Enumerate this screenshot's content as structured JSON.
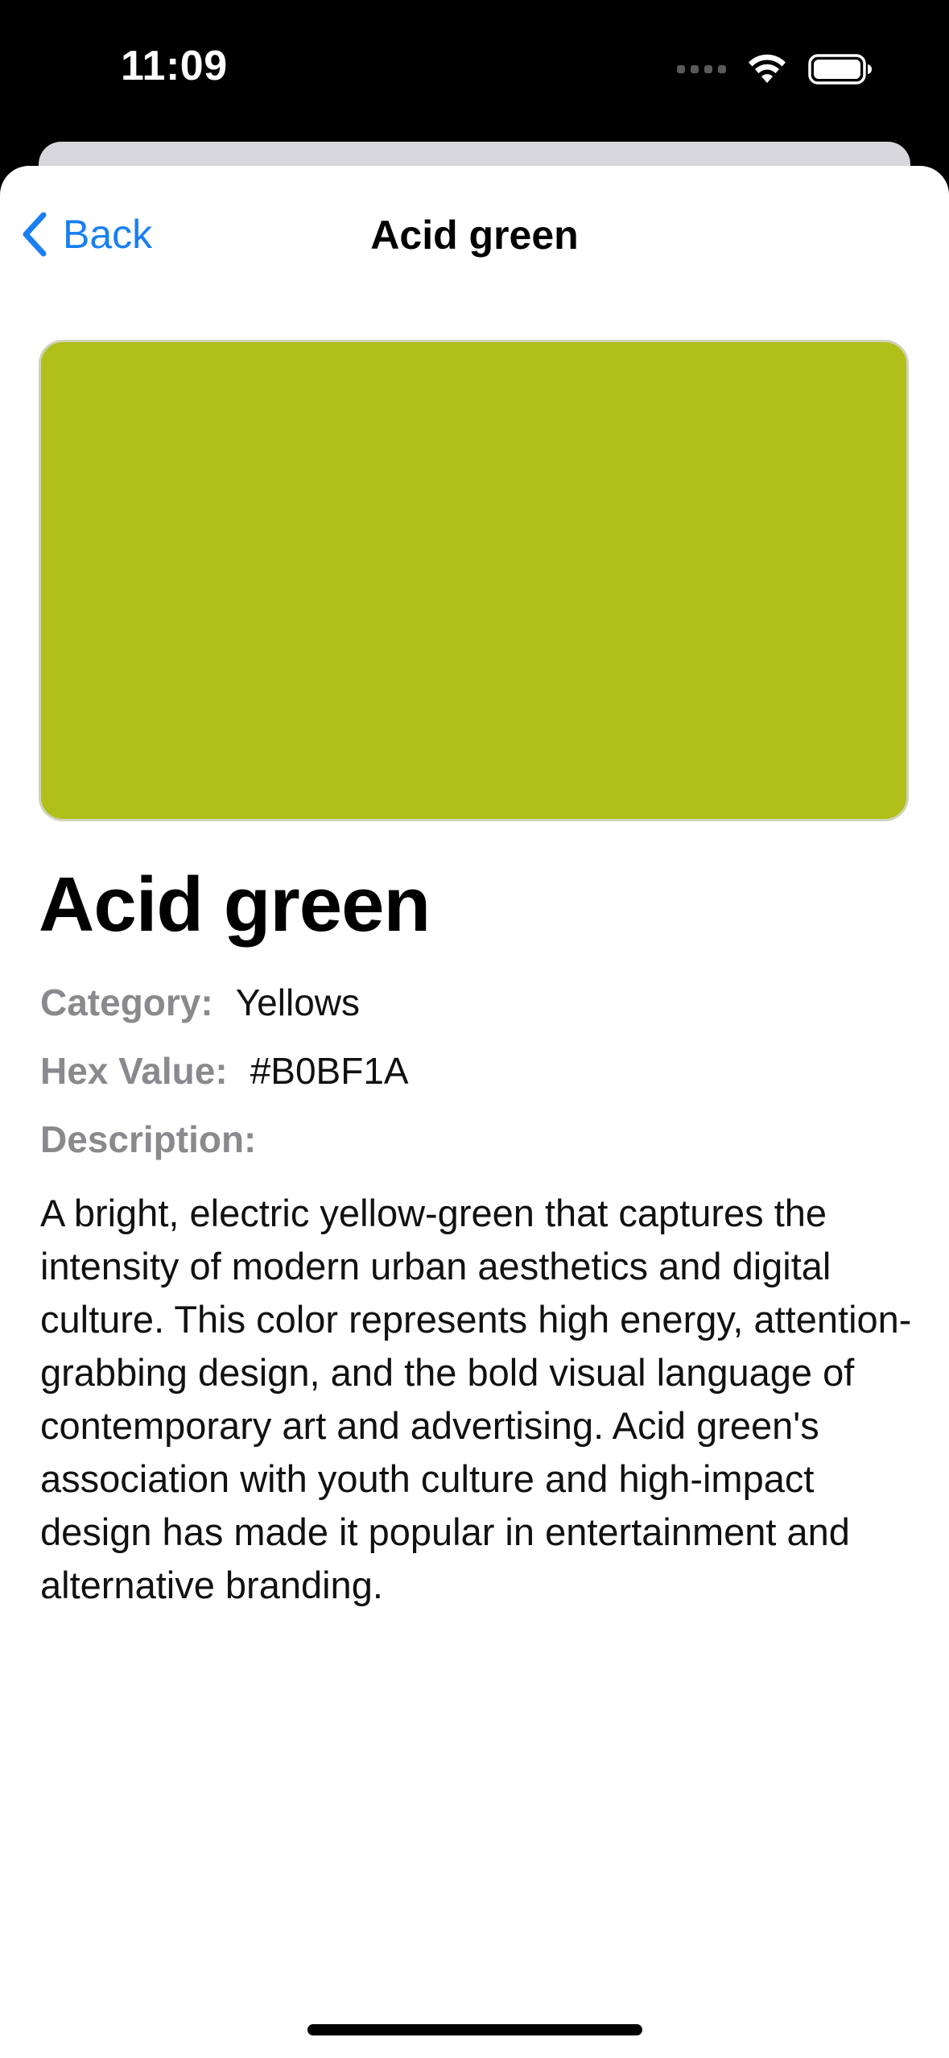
{
  "status_bar": {
    "time": "11:09"
  },
  "nav": {
    "back_label": "Back",
    "title": "Acid green"
  },
  "color": {
    "name": "Acid green",
    "swatch_color": "#B0BF1A",
    "category_label": "Category:",
    "category_value": "Yellows",
    "hex_label": "Hex Value:",
    "hex_value": "#B0BF1A",
    "description_label": "Description:",
    "description": "A bright, electric yellow-green that captures the intensity of modern urban aesthetics and digital culture. This color represents high energy, attention-grabbing design, and the bold visual language of contemporary art and advertising. Acid green's association with youth culture and high-impact design has made it popular in entertainment and alternative branding."
  },
  "theme": {
    "accent": "#1A7FF0",
    "label_gray": "#8A8A8E"
  },
  "icons": {
    "back": "chevron-left-icon",
    "signal": "cellular-signal-icon",
    "wifi": "wifi-icon",
    "battery": "battery-icon"
  }
}
